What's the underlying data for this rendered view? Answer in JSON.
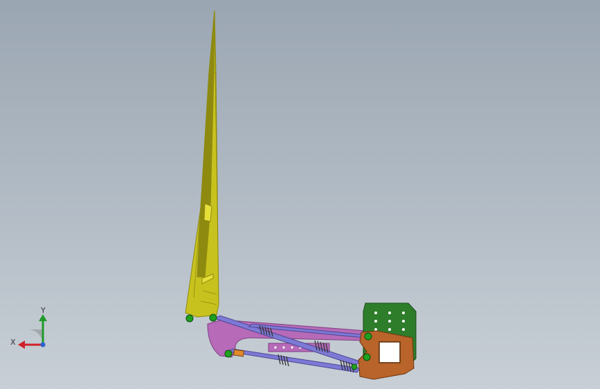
{
  "viewport": {
    "background_top": "#9aa6b2",
    "background_bottom": "#c8cfd6"
  },
  "model": {
    "colors": {
      "boom": "#c8c21e",
      "boom_dark": "#8e8a10",
      "boom_highlight": "#e6df3a",
      "linkage": "#b66ab8",
      "linkage_dark": "#7e3f80",
      "rod": "#7d79d6",
      "rod_dark": "#4b4690",
      "bracket": "#b8642a",
      "bracket_dark": "#6e3510",
      "plate": "#2e7d2b",
      "plate_dark": "#174a16",
      "joint": "#1fa01f",
      "spring": "#333333",
      "collar": "#e08a2a"
    }
  },
  "triad": {
    "x_label": "X",
    "y_label": "Y",
    "x_color": "#d0202a",
    "y_color": "#1f9a2a"
  }
}
